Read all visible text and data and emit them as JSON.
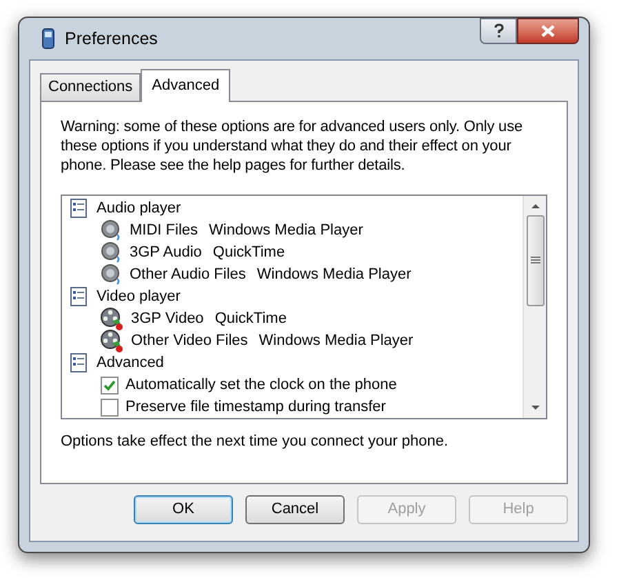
{
  "window": {
    "title": "Preferences"
  },
  "tabs": [
    {
      "label": "Connections",
      "selected": false
    },
    {
      "label": "Advanced",
      "selected": true
    }
  ],
  "warning": "Warning: some of these options are for advanced users only.  Only use these options if you understand what they do and their effect on your phone.  Please see the help pages for further details.",
  "tree": [
    {
      "label": "Audio player",
      "children": [
        {
          "kind": "audio",
          "name": "MIDI Files",
          "value": "Windows Media Player"
        },
        {
          "kind": "audio",
          "name": "3GP Audio",
          "value": "QuickTime"
        },
        {
          "kind": "audio",
          "name": "Other Audio Files",
          "value": "Windows Media Player"
        }
      ]
    },
    {
      "label": "Video player",
      "children": [
        {
          "kind": "video",
          "name": "3GP Video",
          "value": "QuickTime"
        },
        {
          "kind": "video",
          "name": "Other Video Files",
          "value": "Windows Media Player"
        }
      ]
    },
    {
      "label": "Advanced",
      "children": [
        {
          "kind": "checkbox",
          "name": "Automatically set the clock on the phone",
          "checked": true
        },
        {
          "kind": "checkbox",
          "name": "Preserve file timestamp during transfer",
          "checked": false
        }
      ]
    }
  ],
  "note": "Options take effect the next time you connect your phone.",
  "buttons": [
    {
      "label": "OK",
      "default": true,
      "disabled": false
    },
    {
      "label": "Cancel",
      "default": false,
      "disabled": false
    },
    {
      "label": "Apply",
      "default": false,
      "disabled": true
    },
    {
      "label": "Help",
      "default": false,
      "disabled": true
    }
  ]
}
